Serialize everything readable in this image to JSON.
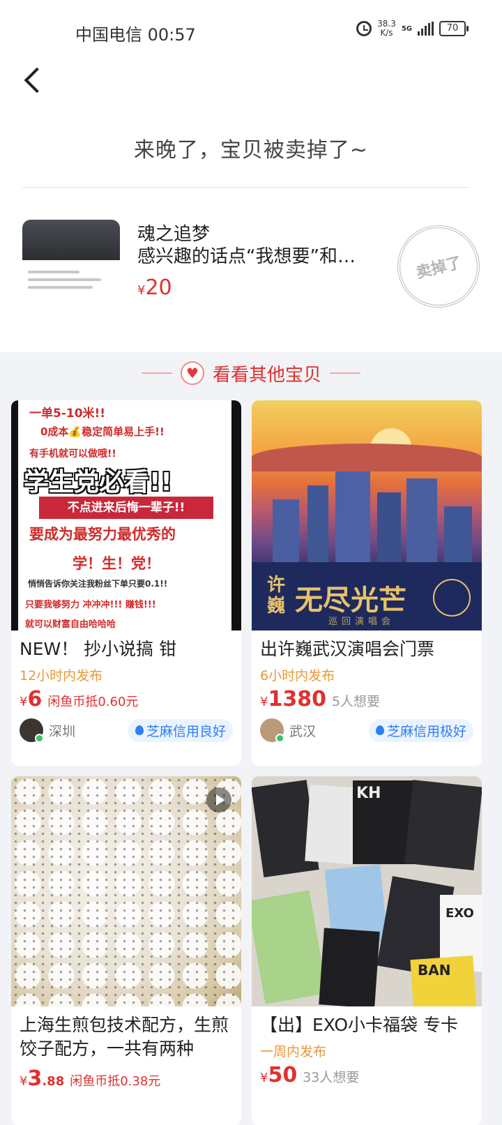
{
  "status_bar": {
    "carrier_time": "中国电信 00:57",
    "speed_value": "38.3",
    "speed_unit": "K/s",
    "network": "5G",
    "battery": "70"
  },
  "header": {
    "sold_title": "来晚了，宝贝被卖掉了~"
  },
  "item": {
    "seller": "魂之追梦",
    "description": "感兴趣的话点“我想要”和…",
    "currency": "¥",
    "price": "20",
    "stamp": "卖掉了"
  },
  "section": {
    "title": "看看其他宝贝"
  },
  "cards": [
    {
      "image_text": [
        "一单5-10米!!",
        "0成本💰稳定简单易上手!!",
        "有手机就可以做哦!!",
        "学生党必看!!",
        "不点进来后悔一辈子!!",
        "要成为最努力最优秀的",
        "学！生！党！",
        "悄悄告诉你关注我粉丝下单只要0.1!!",
        "只要我够努力 冲冲冲!!! 赚钱!!!",
        "就可以财富自由哈哈哈"
      ],
      "title": "NEW！ 抄小说搞 钳",
      "time": "12小时内发布",
      "currency": "¥",
      "price": "6",
      "sub": "闲鱼币抵0.60元",
      "location": "深圳",
      "credit": "芝麻信用良好"
    },
    {
      "image_text": [
        "许巍",
        "无尽光芒",
        "巡回演唱会"
      ],
      "title": "出许巍武汉演唱会门票",
      "time": "6小时内发布",
      "currency": "¥",
      "price": "1380",
      "want": "5人想要",
      "location": "武汉",
      "credit": "芝麻信用极好"
    },
    {
      "title": "上海生煎包技术配方，生煎饺子配方，一共有两种",
      "currency": "¥",
      "price_int": "3",
      "price_dec": ".88",
      "sub": "闲鱼币抵0.38元"
    },
    {
      "image_text": [
        "KH",
        "EXO",
        "BAN"
      ],
      "title": "【出】EXO小卡福袋 专卡",
      "time": "一周内发布",
      "currency": "¥",
      "price": "50",
      "want": "33人想要"
    }
  ]
}
